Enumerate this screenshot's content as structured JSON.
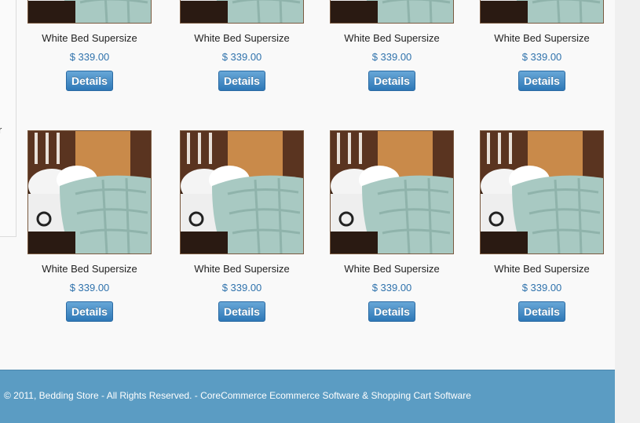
{
  "sidebar": {
    "text_fragment": "r"
  },
  "products": [
    {
      "name": "White Bed Supersize",
      "price": "$ 339.00",
      "button": "Details"
    },
    {
      "name": "White Bed Supersize",
      "price": "$ 339.00",
      "button": "Details"
    },
    {
      "name": "White Bed Supersize",
      "price": "$ 339.00",
      "button": "Details"
    },
    {
      "name": "White Bed Supersize",
      "price": "$ 339.00",
      "button": "Details"
    },
    {
      "name": "White Bed Supersize",
      "price": "$ 339.00",
      "button": "Details"
    },
    {
      "name": "White Bed Supersize",
      "price": "$ 339.00",
      "button": "Details"
    },
    {
      "name": "White Bed Supersize",
      "price": "$ 339.00",
      "button": "Details"
    },
    {
      "name": "White Bed Supersize",
      "price": "$ 339.00",
      "button": "Details"
    }
  ],
  "footer": {
    "text": "© 2011, Bedding Store - All Rights Reserved. - CoreCommerce Ecommerce Software & Shopping Cart Software"
  },
  "colors": {
    "footer_bg": "#5b9cc3",
    "price": "#2f72ac",
    "button": "#3a84c0"
  }
}
